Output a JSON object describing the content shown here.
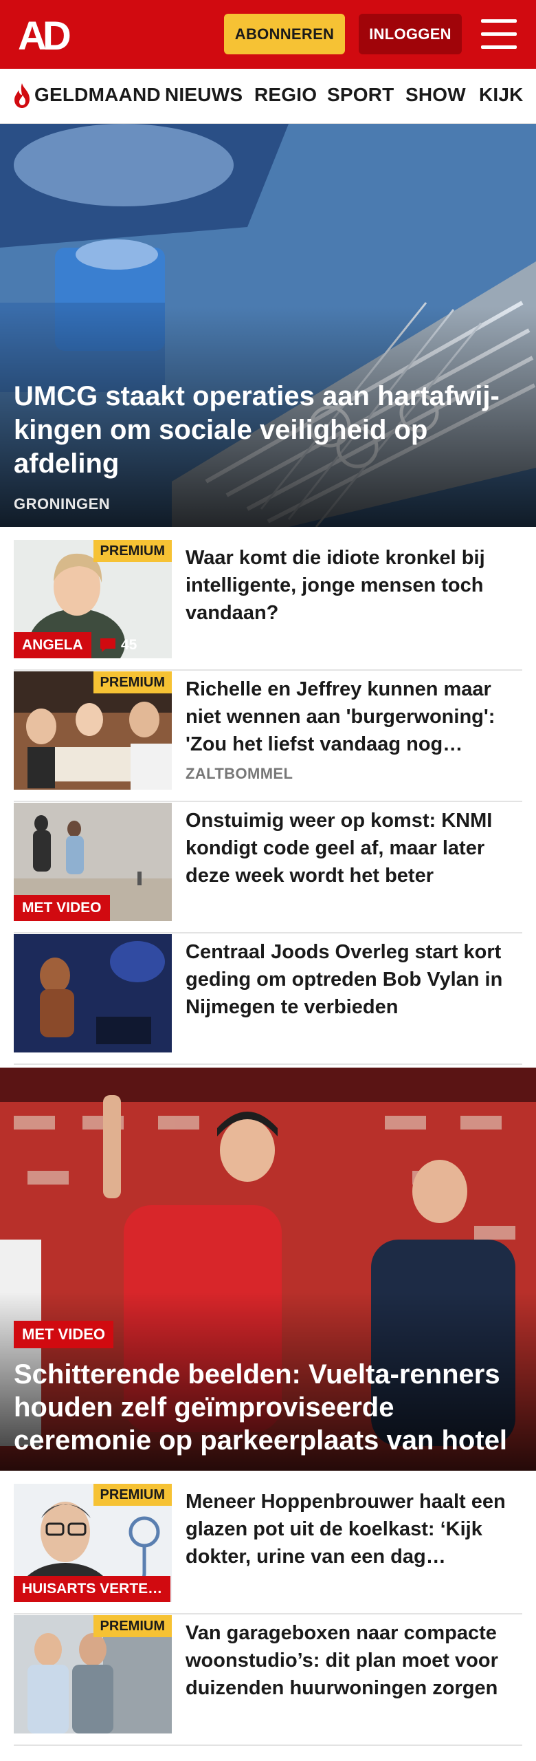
{
  "header": {
    "logo_text": "AD",
    "subscribe_label": "ABONNEREN",
    "login_label": "INLOGGEN",
    "brand_color": "#d10a10"
  },
  "nav": {
    "items": [
      "GELDMAAND",
      "NIEUWS",
      "REGIO",
      "SPORT",
      "SHOW",
      "KIJK"
    ]
  },
  "hero": {
    "title": "UMCG staakt operaties aan hartafwij­kingen om sociale veiligheid op afdeling",
    "kicker": "GRONINGEN"
  },
  "articles": [
    {
      "title": "Waar komt die idiote kronkel bij intelligente, jonge mensen toch vandaan?",
      "premium": "PREMIUM",
      "label": "ANGELA",
      "comments": "45",
      "kicker": ""
    },
    {
      "title": "Richelle en Jeffrey kunnen maar niet wennen aan 'burgerwoning': 'Zou het liefst vandaag nog…",
      "premium": "PREMIUM",
      "label": "",
      "comments": "",
      "kicker": "ZALTBOMMEL"
    },
    {
      "title": "Onstuimig weer op komst: KNMI kondigt code geel af, maar later deze week wordt het beter",
      "premium": "",
      "label": "MET VIDEO",
      "comments": "",
      "kicker": ""
    },
    {
      "title": "Centraal Joods Overleg start kort geding om optreden Bob Vylan in Nijmegen te verbieden",
      "premium": "",
      "label": "",
      "comments": "",
      "kicker": ""
    }
  ],
  "video_hero": {
    "badge": "MET VIDEO",
    "title": "Schitterende beelden: Vuelta-renners houden zelf geïmproviseerde ceremonie op parkeerplaats van hotel"
  },
  "articles_2": [
    {
      "title": "Meneer Hoppenbrouwer haalt een glazen pot uit de koelkast: ‘Kijk dokter, urine van een dag…",
      "premium": "PREMIUM",
      "label": "HUISARTS VERTE…"
    },
    {
      "title": "Van garageboxen naar compacte woonstudio’s: dit plan moet voor duizenden huurwoningen zorgen",
      "premium": "PREMIUM",
      "label": ""
    }
  ]
}
